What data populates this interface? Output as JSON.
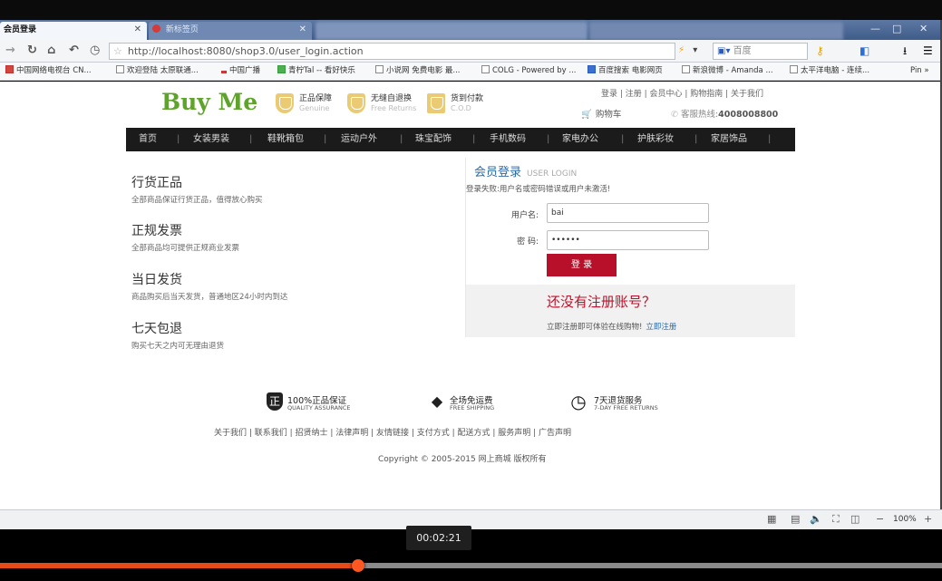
{
  "browser": {
    "tabs": [
      {
        "label": "会员登录",
        "active": true
      },
      {
        "label": "新标签页",
        "active": false
      }
    ],
    "window_controls": [
      "—",
      "□",
      "✕"
    ],
    "address": "http://localhost:8080/shop3.0/user_login.action",
    "search_placeholder": "百度",
    "bookmarks": [
      "中国网络电视台 CN...",
      "欢迎登陆 太原联通...",
      "中国广播",
      "青柠Tal -- 看好快乐",
      "小说网 免费电影 最...",
      "COLG - Powered by ...",
      "百度搜索 电影网页",
      "新浪微博 - Amanda ...",
      "太平洋电脑 - 连续..."
    ],
    "bookmarks_more": "Pin »",
    "zoom": "100%"
  },
  "site": {
    "logo": "Buy Me",
    "badges": [
      {
        "title": "正品保障",
        "sub": "Genuine"
      },
      {
        "title": "无缝自退换",
        "sub": "Free Returns"
      },
      {
        "title": "货到付款",
        "sub": "C.O.D"
      }
    ],
    "top_links": "登录 | 注册 | 会员中心 | 购物指南 | 关于我们",
    "cart": "购物车",
    "hotline_label": "客服热线:",
    "hotline_number": "4008008800",
    "nav": [
      "首页",
      "女装男装",
      "鞋靴箱包",
      "运动户外",
      "珠宝配饰",
      "手机数码",
      "家电办公",
      "护肤彩妆",
      "家居饰品"
    ],
    "features": [
      {
        "title": "行货正品",
        "desc": "全部商品保证行货正品，值得放心购买"
      },
      {
        "title": "正规发票",
        "desc": "全部商品均可提供正规商业发票"
      },
      {
        "title": "当日发货",
        "desc": "商品购买后当天发货，普通地区24小时内到达"
      },
      {
        "title": "七天包退",
        "desc": "购买七天之内可无理由退货"
      }
    ],
    "login": {
      "title": "会员登录",
      "title_en": "USER LOGIN",
      "error": "登录失败:用户名或密码错误或用户未激活!",
      "username_label": "用户名:",
      "username_value": "bai",
      "password_label": "密 码:",
      "password_value": "••••••",
      "submit": "登 录",
      "register_title": "还没有注册账号？",
      "register_text": "立即注册即可体验在线购物!",
      "register_link": "立即注册"
    },
    "services": [
      {
        "icon": "正",
        "title": "100%正品保证",
        "sub": "QUALITY ASSURANCE"
      },
      {
        "icon": "◆",
        "title": "全场免运费",
        "sub": "FREE SHIPPING"
      },
      {
        "icon": "◷",
        "title": "7天退货服务",
        "sub": "7-DAY FREE RETURNS"
      }
    ],
    "footer_links": "关于我们 | 联系我们 | 招贤纳士 | 法律声明 | 友情链接 | 支付方式 | 配送方式 | 服务声明 | 广告声明",
    "copyright": "Copyright © 2005-2015 网上商城 版权所有"
  },
  "player": {
    "timestamp": "00:02:21",
    "progress": 0.38
  }
}
